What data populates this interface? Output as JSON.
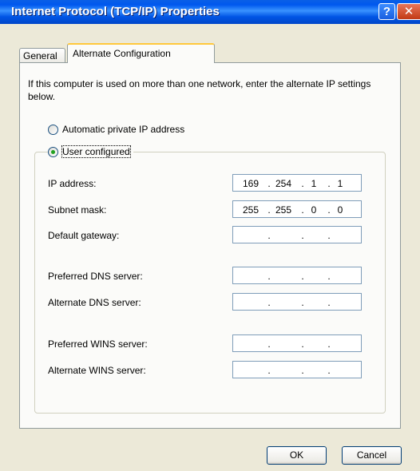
{
  "window": {
    "title": "Internet Protocol (TCP/IP) Properties",
    "help_glyph": "?",
    "close_glyph": "✕"
  },
  "tabs": [
    {
      "label": "General",
      "selected": false
    },
    {
      "label": "Alternate Configuration",
      "selected": true
    }
  ],
  "intro_text": "If this computer is used on more than one network, enter the alternate IP settings below.",
  "options": {
    "automatic": {
      "label": "Automatic private IP address",
      "checked": false
    },
    "user_configured": {
      "label": "User configured",
      "checked": true
    }
  },
  "fields": {
    "ip_address": {
      "label": "IP address:",
      "octets": [
        "169",
        "254",
        "1",
        "1"
      ]
    },
    "subnet_mask": {
      "label": "Subnet mask:",
      "octets": [
        "255",
        "255",
        "0",
        "0"
      ]
    },
    "default_gateway": {
      "label": "Default gateway:",
      "octets": [
        "",
        "",
        "",
        ""
      ]
    },
    "preferred_dns": {
      "label": "Preferred DNS server:",
      "octets": [
        "",
        "",
        "",
        ""
      ]
    },
    "alternate_dns": {
      "label": "Alternate DNS server:",
      "octets": [
        "",
        "",
        "",
        ""
      ]
    },
    "preferred_wins": {
      "label": "Preferred WINS server:",
      "octets": [
        "",
        "",
        "",
        ""
      ]
    },
    "alternate_wins": {
      "label": "Alternate WINS server:",
      "octets": [
        "",
        "",
        "",
        ""
      ]
    }
  },
  "ip_separator": ".",
  "buttons": {
    "ok": "OK",
    "cancel": "Cancel"
  },
  "colors": {
    "titlebar": "#0055E5",
    "dialog_bg": "#ECE9D8",
    "tab_highlight": "#FFC83C",
    "radio_dot": "#21A121"
  }
}
